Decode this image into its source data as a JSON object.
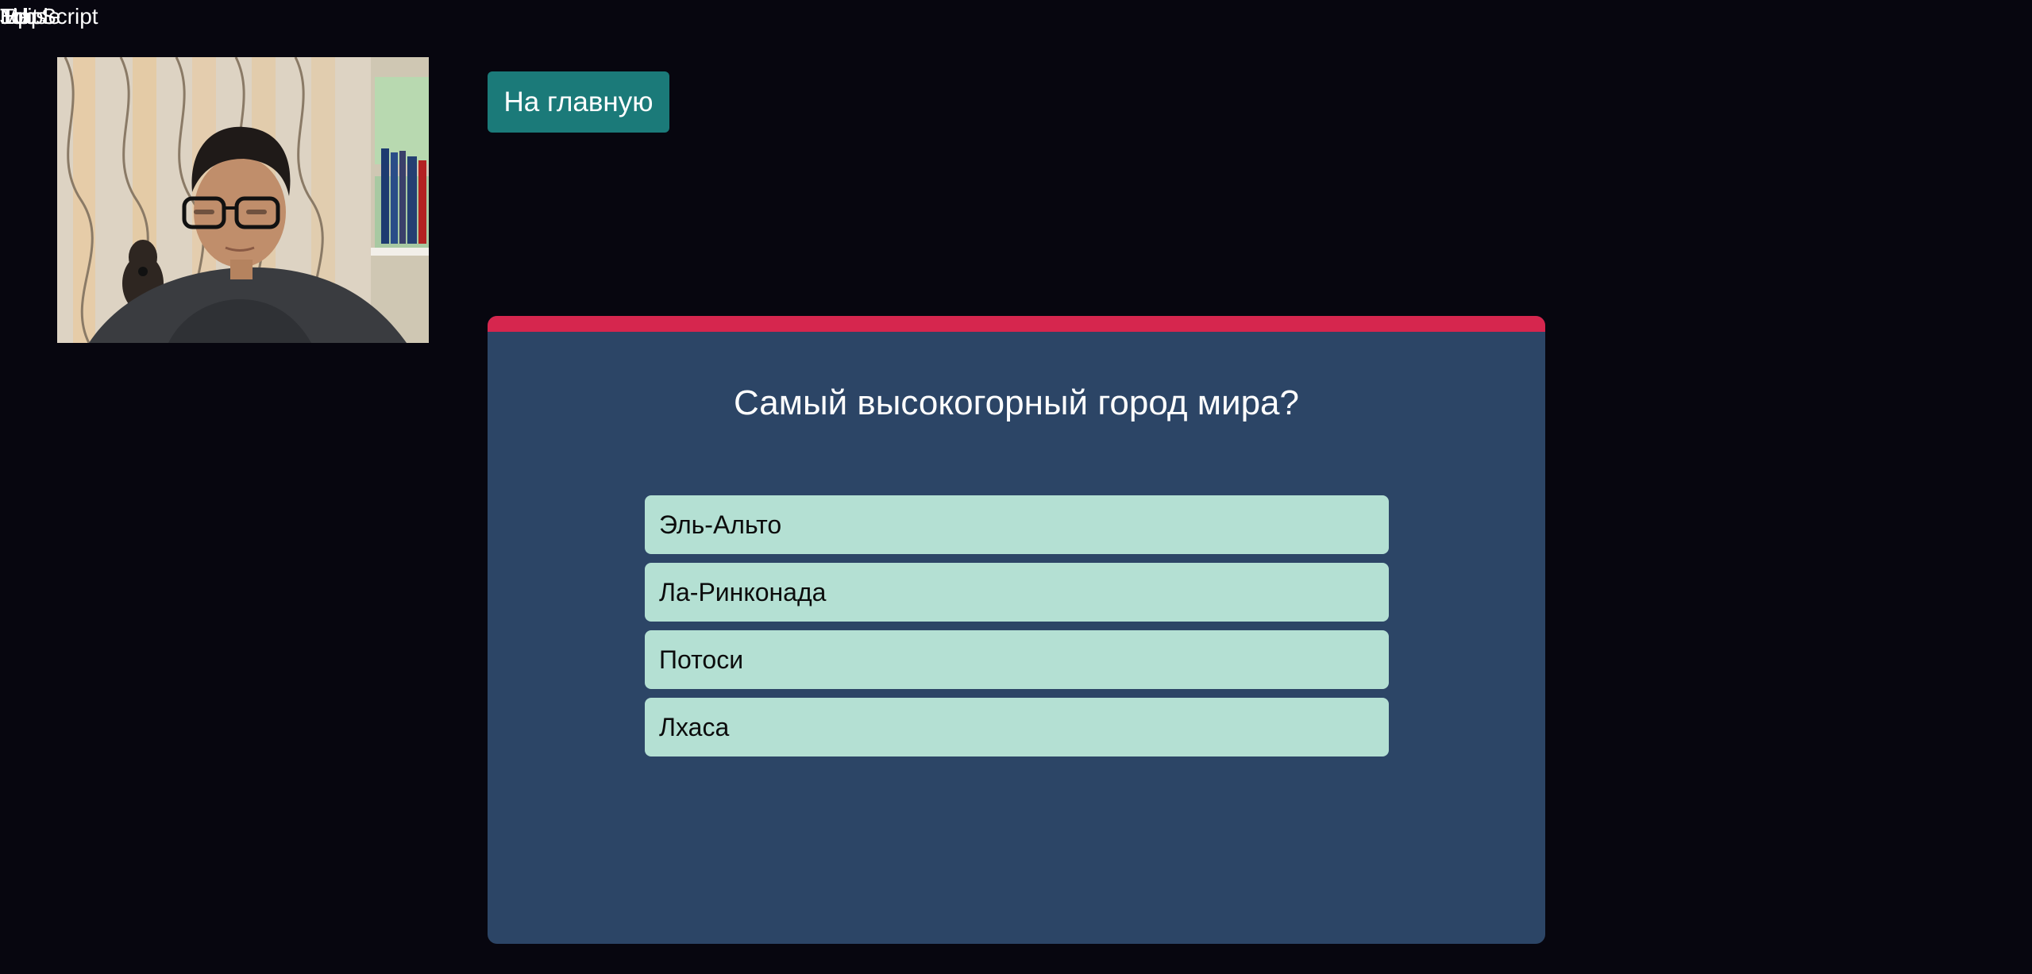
{
  "overlay": {
    "texts": [
      "Maple",
      "Script",
      "Tip",
      "Jobs",
      "Edit"
    ]
  },
  "webcam": {
    "icon": "person-video-feed"
  },
  "nav": {
    "home_label": "На главную"
  },
  "quiz": {
    "accent_color": "#d6264e",
    "card_color": "#2c4566",
    "answer_color": "#b4e0d3",
    "question": "Самый высокогорный город мира?",
    "answers": [
      {
        "label": "Эль-Альто"
      },
      {
        "label": "Ла-Ринконада"
      },
      {
        "label": "Потоси"
      },
      {
        "label": "Лхаса"
      }
    ]
  }
}
